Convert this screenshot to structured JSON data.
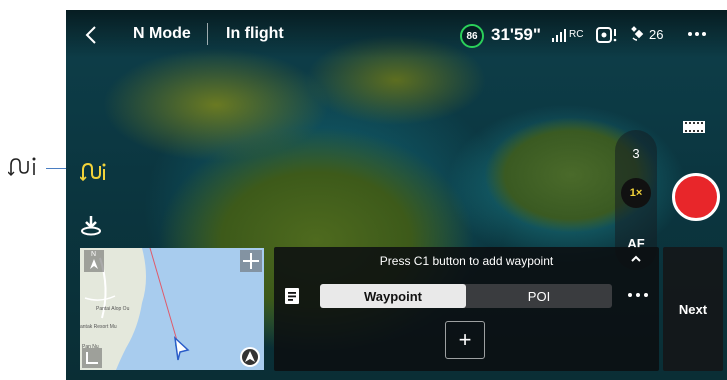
{
  "header": {
    "mode": "N Mode",
    "status": "In flight",
    "battery_percent": "86",
    "flight_time": "31'59\"",
    "rc_label": "RC",
    "satellites": "26",
    "more_icon": "more-dots-icon"
  },
  "camera_controls": {
    "zoom_options": [
      "3",
      "1×"
    ],
    "focus_label": "AF"
  },
  "waypoint_panel": {
    "hint": "Press C1 button to add waypoint",
    "tab_waypoint": "Waypoint",
    "tab_poi": "POI",
    "add_label": "+",
    "next_label": "Next"
  },
  "map": {
    "north_label": "N",
    "place_labels": [
      "Pantai Alop Ou",
      "antak Resort Mu",
      "Pan Nu"
    ]
  },
  "colors": {
    "record": "#e8262a",
    "battery_ring": "#2bd05a",
    "waypoint_accent": "#f2d33a",
    "route": "#e05a6a"
  }
}
